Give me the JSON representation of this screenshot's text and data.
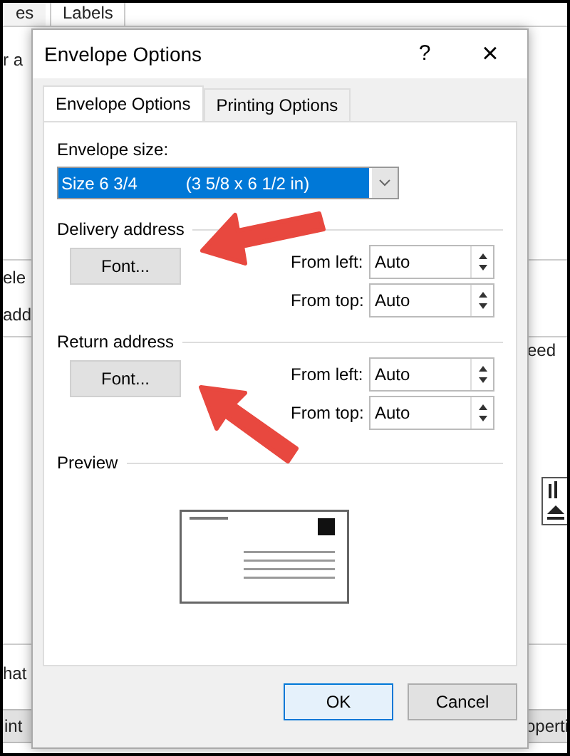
{
  "background_window": {
    "tabs": [
      {
        "label": "es",
        "selected": false
      },
      {
        "label": "Labels",
        "selected": true
      }
    ],
    "left_texts": [
      "r a",
      "ele",
      "add",
      "hat"
    ],
    "right_texts": [
      "eed"
    ],
    "bottom_buttons": [
      "int",
      "operti"
    ]
  },
  "dialog": {
    "title": "Envelope Options",
    "help": "?",
    "close": "×",
    "tabs": [
      {
        "label": "Envelope Options",
        "selected": true
      },
      {
        "label": "Printing Options",
        "selected": false
      }
    ],
    "envelope_size": {
      "label": "Envelope size:",
      "value_name": "Size 6 3/4",
      "value_dims": "(3 5/8 x 6 1/2 in)"
    },
    "sections": [
      {
        "heading": "Delivery address",
        "button": "Font...",
        "fields": [
          {
            "label": "From left:",
            "value": "Auto"
          },
          {
            "label": "From top:",
            "value": "Auto"
          }
        ]
      },
      {
        "heading": "Return address",
        "button": "Font...",
        "fields": [
          {
            "label": "From left:",
            "value": "Auto"
          },
          {
            "label": "From top:",
            "value": "Auto"
          }
        ]
      }
    ],
    "preview": {
      "heading": "Preview"
    },
    "buttons": [
      {
        "label": "OK",
        "default": true
      },
      {
        "label": "Cancel",
        "default": false
      }
    ]
  }
}
